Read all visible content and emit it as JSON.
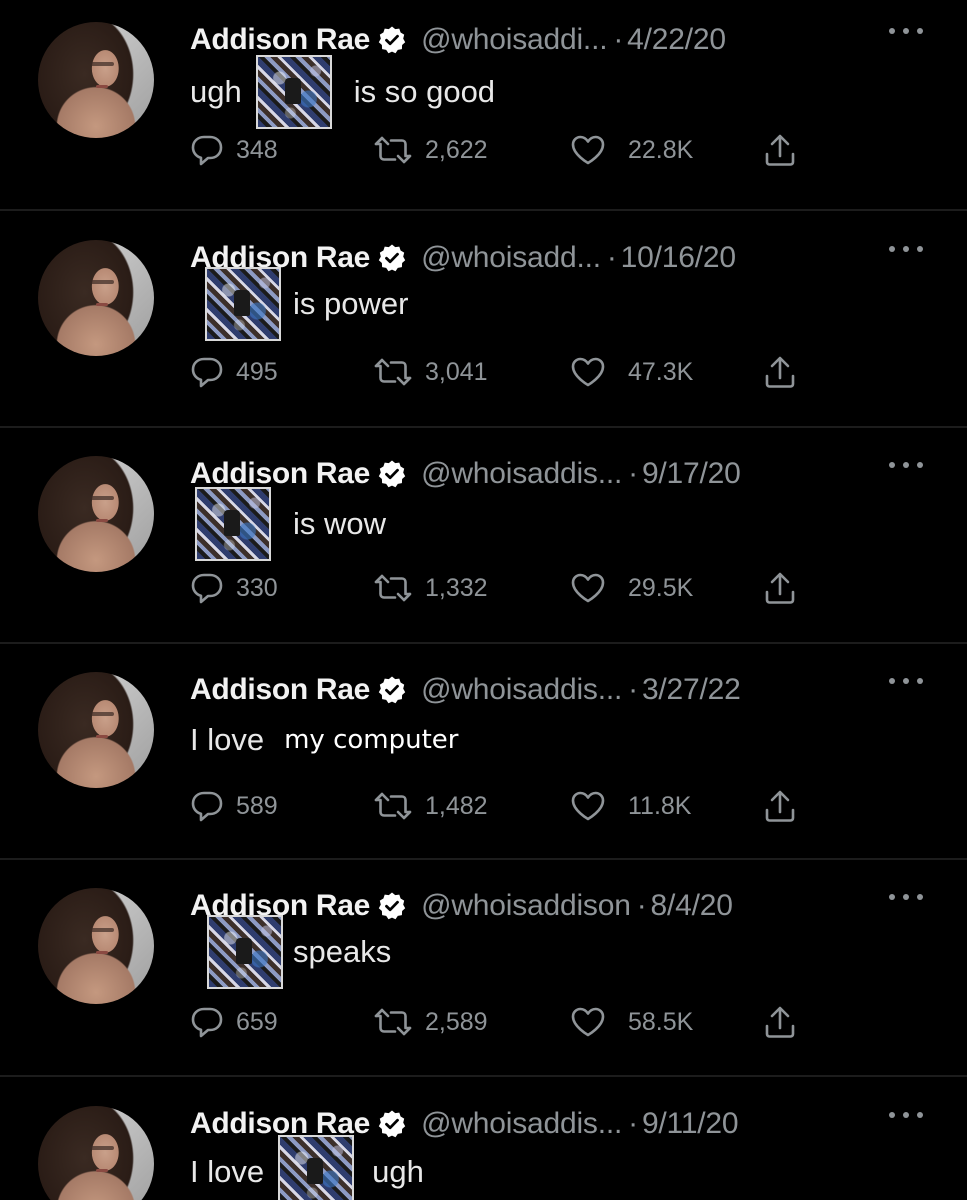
{
  "tweets": [
    {
      "name": "Addison Rae",
      "handle": "@whoisaddi...",
      "sep": "·",
      "date": "4/22/20",
      "text_before": "ugh",
      "has_album_before_text": false,
      "text_after": "is so good",
      "replies": "348",
      "retweets": "2,622",
      "likes": "22.8K"
    },
    {
      "name": "Addison Rae",
      "handle": "@whoisadd...",
      "sep": "·",
      "date": "10/16/20",
      "text_before": "",
      "text_after": "is power",
      "replies": "495",
      "retweets": "3,041",
      "likes": "47.3K"
    },
    {
      "name": "Addison Rae",
      "handle": "@whoisaddis...",
      "sep": "·",
      "date": "9/17/20",
      "text_before": "",
      "text_after": "is wow",
      "replies": "330",
      "retweets": "1,332",
      "likes": "29.5K"
    },
    {
      "name": "Addison Rae",
      "handle": "@whoisaddis...",
      "sep": "·",
      "date": "3/27/22",
      "text_before": "I love",
      "text_after": "my computer",
      "replies": "589",
      "retweets": "1,482",
      "likes": "11.8K"
    },
    {
      "name": "Addison Rae",
      "handle": "@whoisaddison",
      "sep": "·",
      "date": "8/4/20",
      "text_before": "",
      "text_after": "speaks",
      "replies": "659",
      "retweets": "2,589",
      "likes": "58.5K"
    },
    {
      "name": "Addison Rae",
      "handle": "@whoisaddis...",
      "sep": "·",
      "date": "9/11/20",
      "text_before": "I love",
      "text_after": "ugh",
      "replies": "",
      "retweets": "",
      "likes": ""
    }
  ],
  "colors": {
    "background": "#000000",
    "name": "#f2f2f2",
    "meta": "#8f9498",
    "body": "#e8e8e8",
    "verified": "#ffffff",
    "divider": "#1c1c1c"
  },
  "icons": [
    "verified-badge-icon",
    "more-options-icon",
    "reply-icon",
    "retweet-icon",
    "like-icon",
    "share-icon"
  ]
}
